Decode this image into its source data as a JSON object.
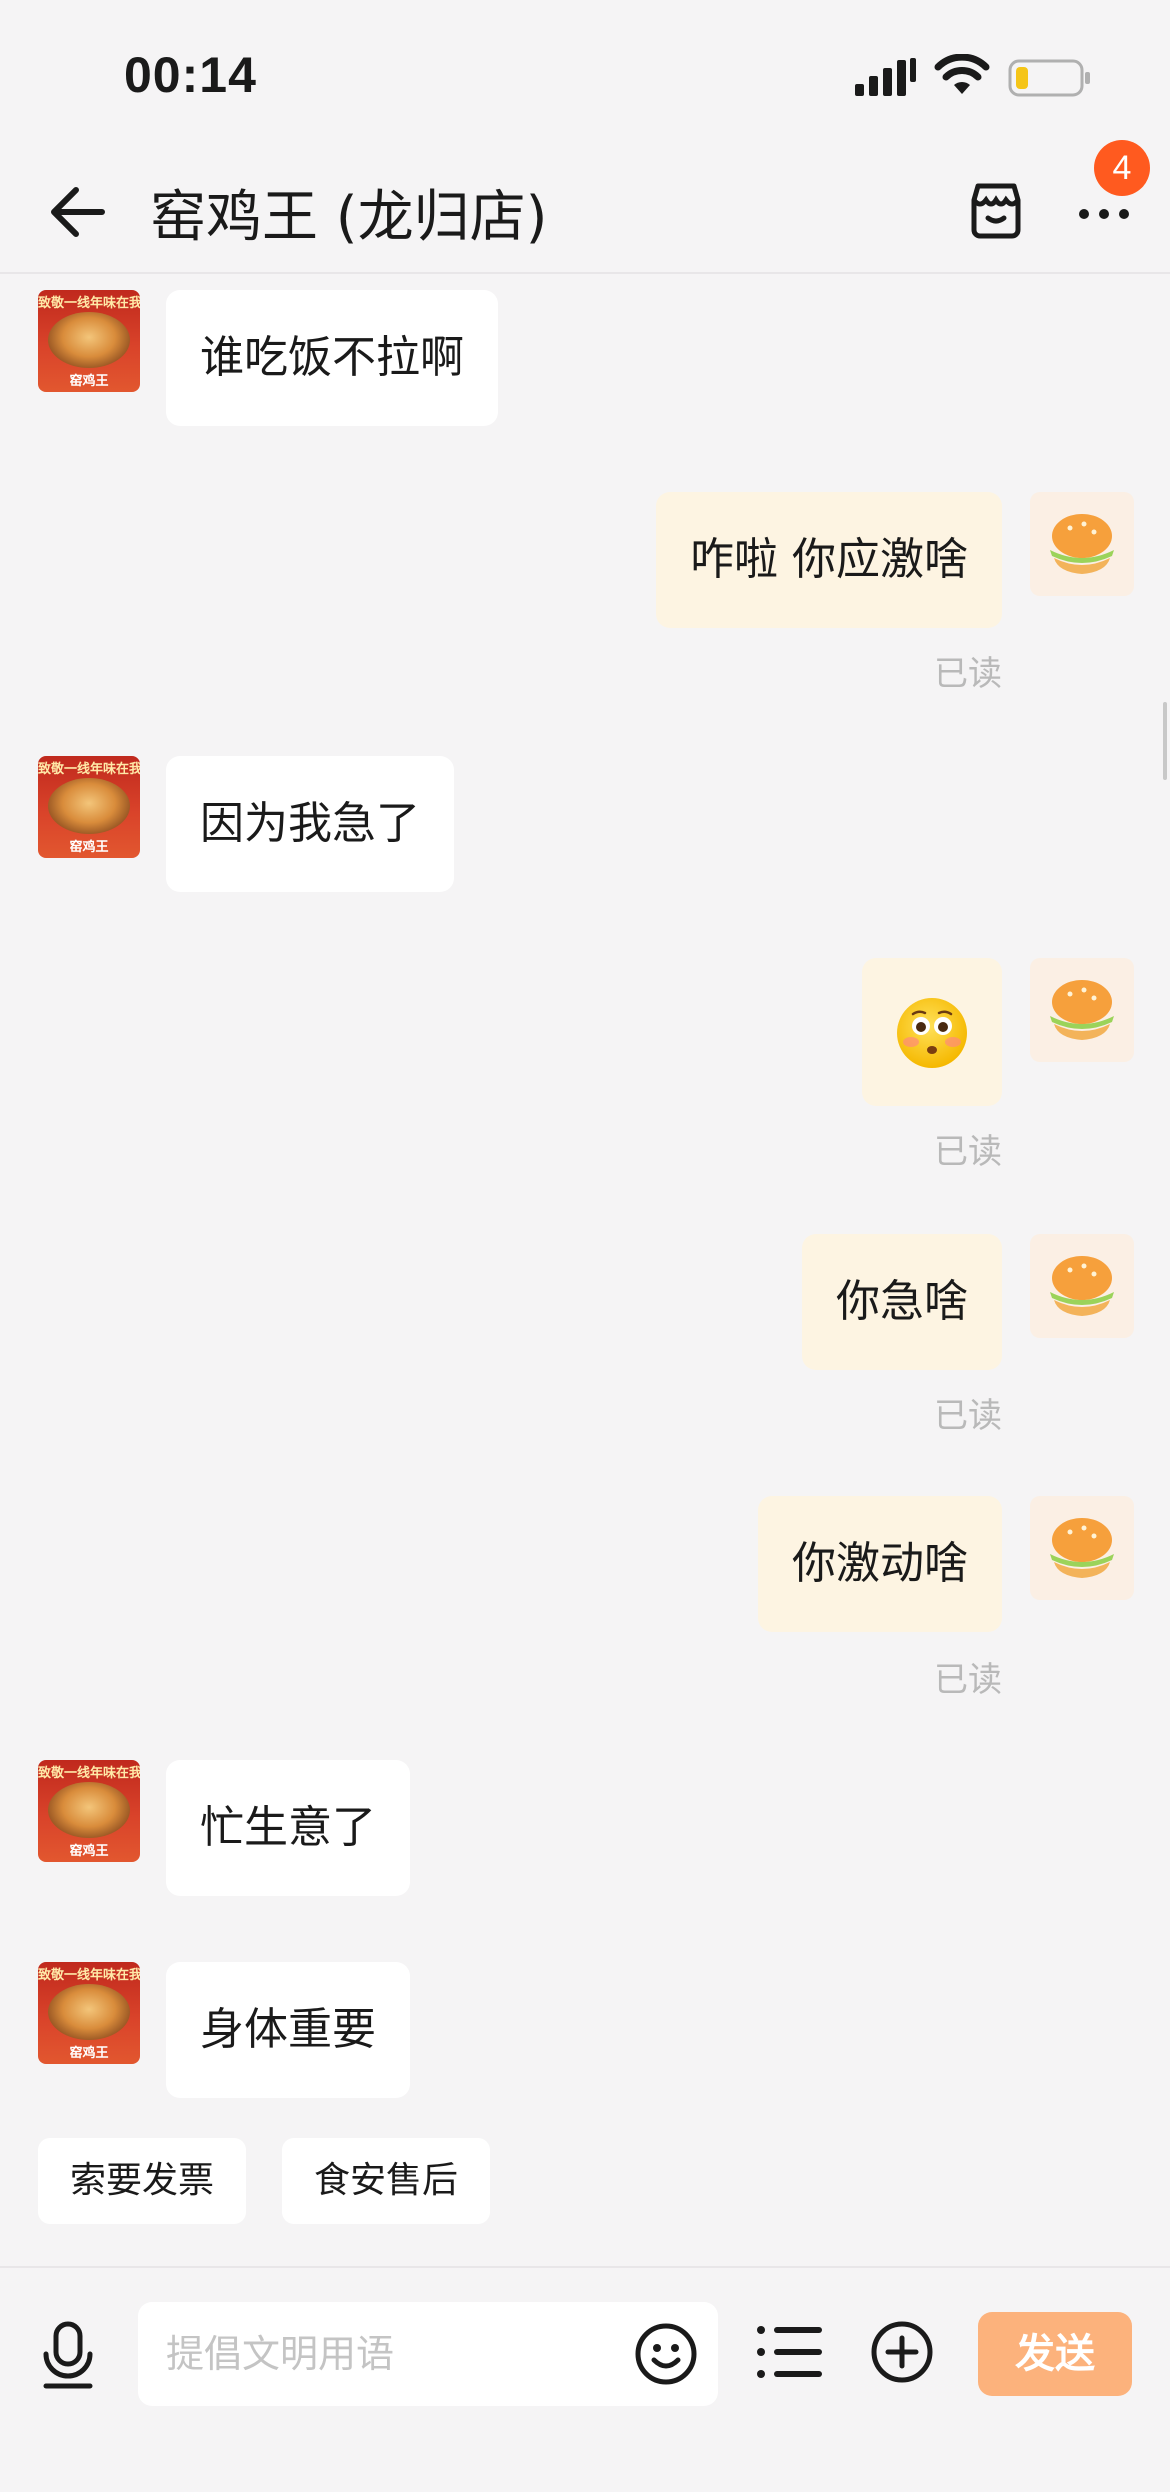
{
  "status_bar": {
    "time": "00:14"
  },
  "header": {
    "title": "窑鸡王 (龙归店)",
    "badge_count": "4"
  },
  "shop_avatar": {
    "banner_text": "致敬一线年味在我",
    "brand_text": "窑鸡王"
  },
  "messages": [
    {
      "side": "left",
      "text": "谁吃饭不拉啊"
    },
    {
      "side": "right",
      "text": "咋啦 你应激啥",
      "status": "已读"
    },
    {
      "side": "left",
      "text": "因为我急了"
    },
    {
      "side": "right",
      "emoji": "flushed-face",
      "status": "已读"
    },
    {
      "side": "right",
      "text": "你急啥",
      "status": "已读"
    },
    {
      "side": "right",
      "text": "你激动啥",
      "status": "已读"
    },
    {
      "side": "left",
      "text": "忙生意了"
    },
    {
      "side": "left",
      "text": "身体重要"
    }
  ],
  "quick_replies": [
    "索要发票",
    "食安售后"
  ],
  "input": {
    "placeholder": "提倡文明用语",
    "send_label": "发送"
  },
  "colors": {
    "accent": "#ff5a1f",
    "send_button": "#fcb27c",
    "my_bubble": "#fdf4e2"
  }
}
